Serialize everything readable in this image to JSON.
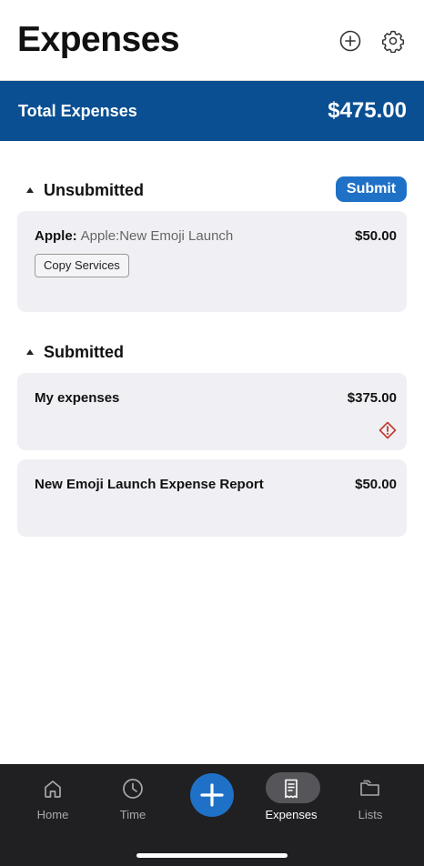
{
  "header": {
    "title": "Expenses",
    "add_icon": "plus-circle-icon",
    "settings_icon": "gear-icon"
  },
  "summary": {
    "label": "Total Expenses",
    "value": "$475.00",
    "color": "#0a4f92"
  },
  "sections": {
    "unsubmitted": {
      "title": "Unsubmitted",
      "submit_label": "Submit",
      "items": [
        {
          "client": "Apple:",
          "project": "Apple:New Emoji Launch",
          "amount": "$50.00",
          "tag": "Copy Services"
        }
      ]
    },
    "submitted": {
      "title": "Submitted",
      "items": [
        {
          "name": "My expenses",
          "amount": "$375.00",
          "icon": "warning-diamond-icon"
        },
        {
          "name": "New Emoji Launch Expense Report",
          "amount": "$50.00"
        }
      ]
    }
  },
  "tabbar": {
    "tabs": [
      {
        "label": "Home",
        "icon": "home-icon"
      },
      {
        "label": "Time",
        "icon": "clock-icon"
      },
      {
        "label": "Expenses",
        "icon": "receipt-icon",
        "active": true
      },
      {
        "label": "Lists",
        "icon": "folders-icon"
      }
    ],
    "fab_icon": "plus-icon",
    "accent": "#1f71c7"
  }
}
